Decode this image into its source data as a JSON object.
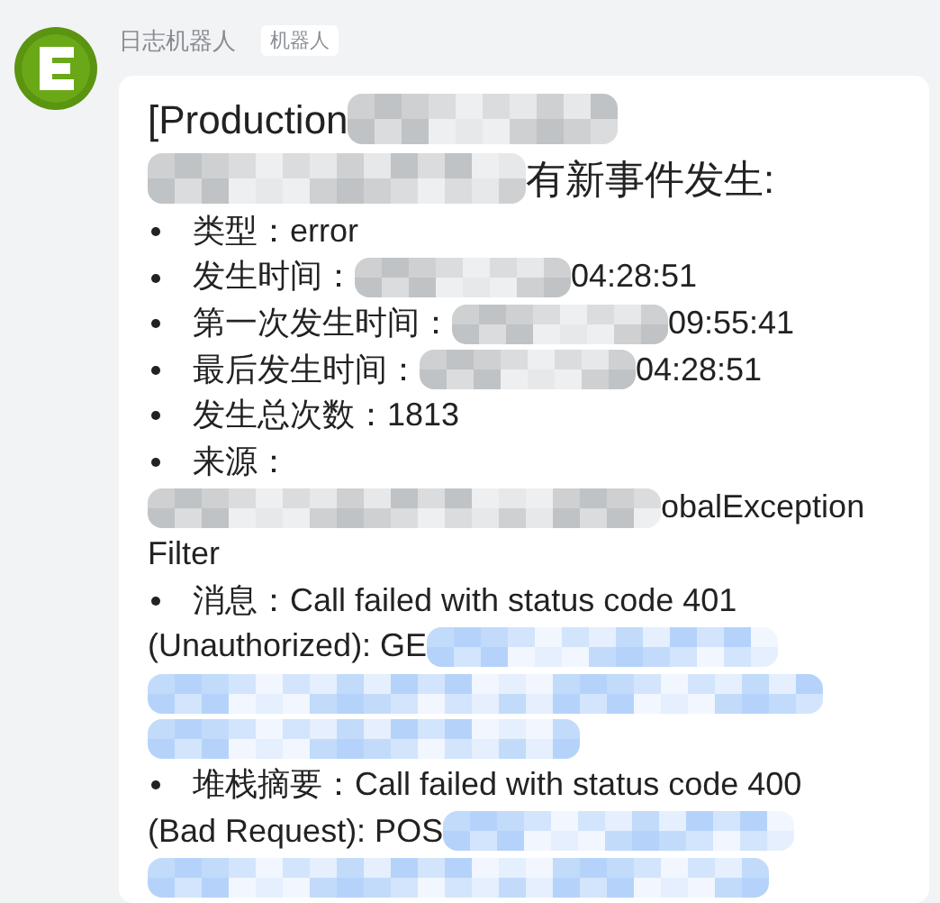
{
  "sender": {
    "name": "日志机器人",
    "tag": "机器人"
  },
  "title": {
    "rows": [
      [
        {
          "kind": "text",
          "text": "[Production"
        },
        {
          "kind": "mask"
        }
      ],
      [
        {
          "kind": "mask"
        },
        {
          "kind": "text",
          "text": "有新事件发生:"
        }
      ]
    ]
  },
  "items": [
    {
      "label": "类型：",
      "label_alone": false,
      "rows": [
        [
          {
            "kind": "text",
            "text": "error"
          }
        ]
      ]
    },
    {
      "label": "发生时间：",
      "label_alone": false,
      "rows": [
        [
          {
            "kind": "mask"
          },
          {
            "kind": "text",
            "text": "04:28:51"
          }
        ]
      ]
    },
    {
      "label": "第一次发生时间：",
      "label_alone": false,
      "rows": [
        [
          {
            "kind": "mask"
          },
          {
            "kind": "text",
            "text": "09:55:41"
          }
        ]
      ]
    },
    {
      "label": "最后发生时间：",
      "label_alone": false,
      "rows": [
        [
          {
            "kind": "mask"
          },
          {
            "kind": "text",
            "text": "04:28:51"
          }
        ]
      ]
    },
    {
      "label": "发生总次数：",
      "label_alone": false,
      "rows": [
        [
          {
            "kind": "text",
            "text": "1813"
          }
        ]
      ]
    },
    {
      "label": "来源：",
      "label_alone": true,
      "rows": [
        [
          {
            "kind": "mask"
          },
          {
            "kind": "text",
            "text": "obalException"
          }
        ],
        [
          {
            "kind": "text",
            "text": "Filter"
          }
        ]
      ]
    },
    {
      "label": "消息：",
      "label_alone": false,
      "rows": [
        [
          {
            "kind": "text",
            "text": "Call failed with status code 401"
          }
        ],
        [
          {
            "kind": "text",
            "text": "(Unauthorized): GE"
          },
          {
            "kind": "linkmask"
          }
        ],
        [
          {
            "kind": "linkmask"
          }
        ],
        [
          {
            "kind": "linkmask"
          }
        ]
      ]
    },
    {
      "label": "堆栈摘要：",
      "label_alone": false,
      "rows": [
        [
          {
            "kind": "text",
            "text": "Call failed with status code 400"
          }
        ],
        [
          {
            "kind": "text",
            "text": "(Bad Request): POS"
          },
          {
            "kind": "linkmask"
          }
        ],
        [
          {
            "kind": "linkmask"
          }
        ]
      ]
    }
  ]
}
